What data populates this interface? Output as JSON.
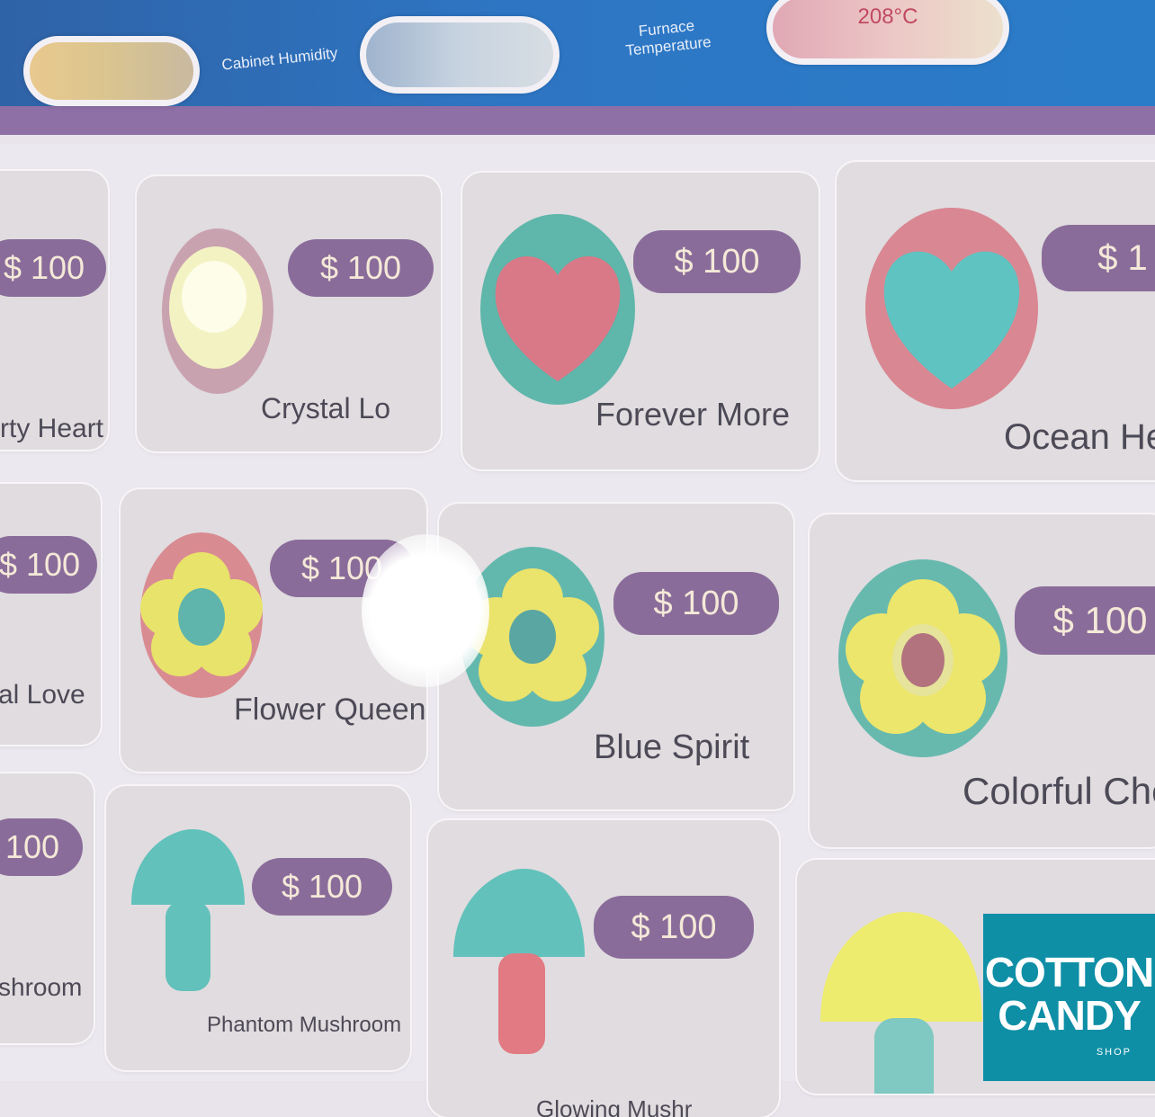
{
  "header": {
    "gauges": [
      {
        "name": "humidity-gauge",
        "value": ""
      },
      {
        "name": "cabinet-humidity-gauge",
        "value": ""
      },
      {
        "name": "furnace-temperature-gauge",
        "value": "208°C"
      }
    ],
    "labels": {
      "cabinet_humidity": "Cabinet Humidity",
      "furnace_temperature_line1": "Furnace",
      "furnace_temperature_line2": "Temperature"
    }
  },
  "products": [
    {
      "name": "rty Heart",
      "price": "$ 100"
    },
    {
      "name": "Crystal Lo",
      "price": "$ 100",
      "icon": "crystal-heart-icon"
    },
    {
      "name": "Forever More",
      "price": "$ 100",
      "icon": "heart-icon"
    },
    {
      "name": "Ocean He",
      "price": "$ 1",
      "icon": "heart-icon"
    },
    {
      "name": "al Love",
      "price": "$ 100"
    },
    {
      "name": "Flower Queen",
      "price": "$ 100",
      "icon": "flower-icon"
    },
    {
      "name": "Blue Spirit",
      "price": "$ 100",
      "icon": "flower-icon"
    },
    {
      "name": "Colorful Che",
      "price": "$ 100",
      "icon": "flower-icon"
    },
    {
      "name": "shroom",
      "price": "100"
    },
    {
      "name": "Phantom Mushroom",
      "price": "$ 100",
      "icon": "mushroom-icon"
    },
    {
      "name": "Glowing Mushr",
      "price": "$ 100",
      "icon": "mushroom-icon"
    },
    {
      "name": "",
      "price": "",
      "icon": "mushroom-icon"
    }
  ],
  "logo": {
    "line1": "COTTON",
    "line2": "CANDY",
    "line3": "SHOP"
  },
  "colors": {
    "header_blue": "#2e76c4",
    "header_stripe": "#8e6fa6",
    "price_pill": "#8a6c9a",
    "card_bg": "#e0dcdf",
    "logo_teal": "#0f8fa6"
  }
}
